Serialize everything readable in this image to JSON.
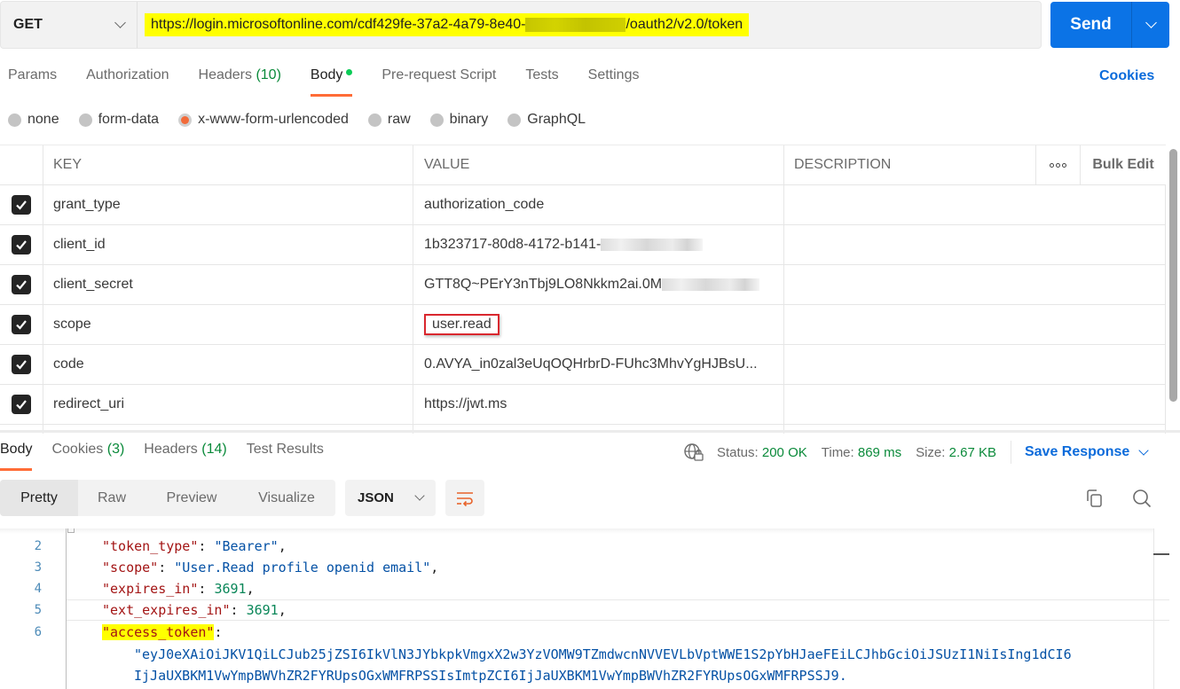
{
  "request": {
    "method": "GET",
    "url_prefix": "https://login.microsoftonline.com/cdf429fe-37a2-4a79-8e40-",
    "url_suffix": "/oauth2/v2.0/token",
    "send_label": "Send"
  },
  "request_tabs": [
    {
      "label": "Params",
      "count": null,
      "active": false
    },
    {
      "label": "Authorization",
      "count": null,
      "active": false
    },
    {
      "label": "Headers",
      "count": "(10)",
      "active": false
    },
    {
      "label": "Body",
      "count": null,
      "active": true
    },
    {
      "label": "Pre-request Script",
      "count": null,
      "active": false
    },
    {
      "label": "Tests",
      "count": null,
      "active": false
    },
    {
      "label": "Settings",
      "count": null,
      "active": false
    }
  ],
  "cookies_link": "Cookies",
  "body_types": [
    {
      "label": "none",
      "selected": false
    },
    {
      "label": "form-data",
      "selected": false
    },
    {
      "label": "x-www-form-urlencoded",
      "selected": true
    },
    {
      "label": "raw",
      "selected": false
    },
    {
      "label": "binary",
      "selected": false
    },
    {
      "label": "GraphQL",
      "selected": false
    }
  ],
  "params_table": {
    "headers": {
      "key": "KEY",
      "value": "VALUE",
      "description": "DESCRIPTION",
      "bulk_edit": "Bulk Edit"
    },
    "rows": [
      {
        "checked": true,
        "key": "grant_type",
        "value": "authorization_code",
        "description": ""
      },
      {
        "checked": true,
        "key": "client_id",
        "value": "1b323717-80d8-4172-b141-",
        "description": ""
      },
      {
        "checked": true,
        "key": "client_secret",
        "value": "GTT8Q~PErY3nTbj9LO8Nkkm2ai.0M",
        "description": ""
      },
      {
        "checked": true,
        "key": "scope",
        "value": "user.read",
        "description": ""
      },
      {
        "checked": true,
        "key": "code",
        "value": "0.AVYA_in0zal3eUqOQHrbrD-FUhc3MhvYgHJBsU...",
        "description": ""
      },
      {
        "checked": true,
        "key": "redirect_uri",
        "value": "https://jwt.ms",
        "description": ""
      }
    ]
  },
  "response_tabs": [
    {
      "label": "Body",
      "count": null,
      "active": true
    },
    {
      "label": "Cookies",
      "count": "(3)",
      "active": false
    },
    {
      "label": "Headers",
      "count": "(14)",
      "active": false
    },
    {
      "label": "Test Results",
      "count": null,
      "active": false
    }
  ],
  "response_meta": {
    "status_label": "Status:",
    "status_value": "200 OK",
    "time_label": "Time:",
    "time_value": "869 ms",
    "size_label": "Size:",
    "size_value": "2.67 KB",
    "save_response": "Save Response"
  },
  "view_modes": [
    {
      "label": "Pretty",
      "active": true
    },
    {
      "label": "Raw",
      "active": false
    },
    {
      "label": "Preview",
      "active": false
    },
    {
      "label": "Visualize",
      "active": false
    }
  ],
  "format": "JSON",
  "code_lines": [
    {
      "num": "2",
      "key": "\"token_type\"",
      "sep": ": ",
      "value": "\"Bearer\"",
      "vtype": "s",
      "tail": ","
    },
    {
      "num": "3",
      "key": "\"scope\"",
      "sep": ": ",
      "value": "\"User.Read profile openid email\"",
      "vtype": "s",
      "tail": ","
    },
    {
      "num": "4",
      "key": "\"expires_in\"",
      "sep": ": ",
      "value": "3691",
      "vtype": "n",
      "tail": ","
    },
    {
      "num": "5",
      "key": "\"ext_expires_in\"",
      "sep": ": ",
      "value": "3691",
      "vtype": "n",
      "tail": ","
    },
    {
      "num": "6",
      "key": "\"access_token\"",
      "sep": ":",
      "value": "",
      "vtype": "s",
      "tail": ""
    }
  ],
  "token_lines": [
    "\"eyJ0eXAiOiJKV1QiLCJub25jZSI6IkVlN3JYbkpkVmgxX2w3YzVOMW9TZmdwcnNVVEVLbVptWWE1S2pYbHJaeFEiLCJhbGciOiJSUzI1NiIsIng1dCI6",
    "IjJaUXBKM1VwYmpBWVhZR2FYRUpsOGxWMFRPSSIsImtpZCI6IjJaUXBKM1VwYmpBWVhZR2FYRUpsOGxWMFRPSSJ9."
  ],
  "colors": {
    "accent": "#ff6c37",
    "send_button": "#0b73e6",
    "link": "#0b6bdb",
    "success": "#0a8a3a",
    "highlight": "#ffff00",
    "annotation_box": "#d9272e"
  }
}
